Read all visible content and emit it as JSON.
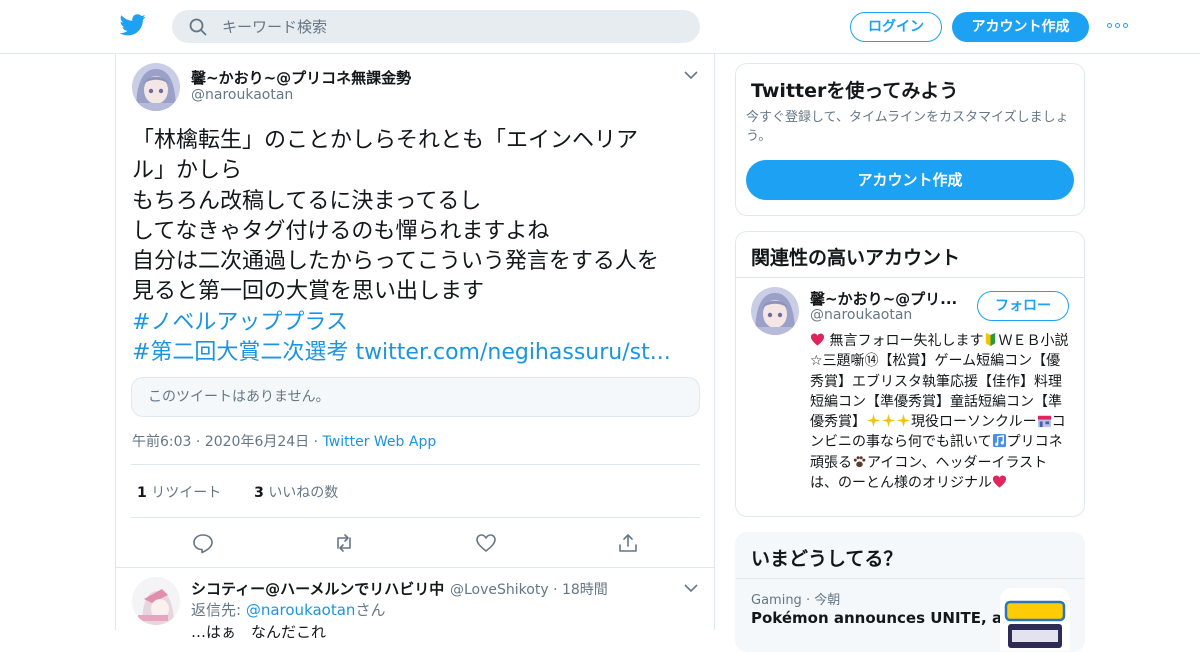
{
  "header": {
    "search_placeholder": "キーワード検索",
    "login_label": "ログイン",
    "signup_label": "アカウント作成"
  },
  "tweet": {
    "author_name": "馨~かおり~@プリコネ無課金勢",
    "author_handle": "@naroukaotan",
    "text_lines": [
      "「林檎転生」のことかしらそれとも「エインヘリア",
      "ル」かしら",
      "もちろん改稿してるに決まってるし",
      "してなきゃタグ付けるのも憚られますよね",
      "自分は二次通過したからってこういう発言をする人を",
      "見ると第一回の大賞を思い出します"
    ],
    "hashtag1": "#ノベルアッププラス",
    "hashtag2": "#第二回大賞二次選考",
    "link": "twitter.com/negihassuru/st...",
    "quote_unavailable": "このツイートはありません。",
    "time": "午前6:03",
    "date": "2020年6月24日",
    "source": "Twitter Web App",
    "retweet_count": "1",
    "retweet_label": "リツイート",
    "like_count": "3",
    "like_label": "いいねの数"
  },
  "reply": {
    "author_name": "シコティー@ハーメルンでリハビリ中",
    "author_handle": "@LoveShikoty",
    "time": "18時間",
    "replying_to_label": "返信先:",
    "replying_to_handle": "@naroukaotan",
    "replying_to_suffix": "さん",
    "text_partial": "…はぁ　なんだこれ"
  },
  "sidebar": {
    "try_twitter": {
      "title": "Twitterを使ってみよう",
      "desc": "今すぐ登録して、タイムラインをカスタマイズしましょう。",
      "button": "アカウント作成"
    },
    "related": {
      "title": "関連性の高いアカウント",
      "name": "馨~かおり~@プリ...",
      "handle": "@naroukaotan",
      "follow_label": "フォロー",
      "bio_1": "無言フォロー失礼します",
      "bio_2": "ＷＥＢ小説☆三題噺⑭【松賞】ゲーム短編コン【優秀賞】エブリスタ執筆応援【佳作】料理短編コン【準優秀賞】童話短編コン【準優秀賞】",
      "bio_3": "現役ローソンクルー",
      "bio_4": "コンビニの事なら何でも訊いて",
      "bio_5": "プリコネ頑張る",
      "bio_6": "アイコン、ヘッダーイラストは、のーとん様のオリジナル"
    },
    "trends": {
      "title": "いまどうしてる？",
      "category": "Gaming",
      "time": "今朝",
      "headline": "Pokémon announces UNITE, a"
    }
  },
  "colors": {
    "brand": "#1da1f2",
    "link": "#1b95e0",
    "text": "#14171a",
    "muted": "#657786",
    "border": "#e1e8ed"
  }
}
